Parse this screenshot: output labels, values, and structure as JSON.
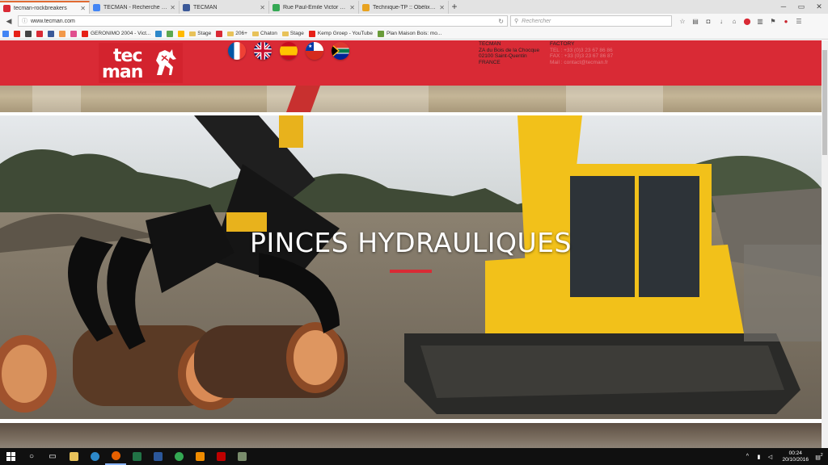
{
  "browser": {
    "tabs": [
      {
        "title": "tecman-rockbreakers",
        "favicon_color": "#d92a35",
        "active": true
      },
      {
        "title": "TECMAN - Recherche Go...",
        "favicon_color": "#4285f4",
        "active": false
      },
      {
        "title": "TECMAN",
        "favicon_color": "#3b5998",
        "active": false
      },
      {
        "title": "Rue Paul-Emile Victor - G...",
        "favicon_color": "#34a853",
        "active": false
      },
      {
        "title": "Technique-TP :: Obélix de ...",
        "favicon_color": "#e8a21f",
        "active": false
      }
    ],
    "new_tab_label": "+",
    "url": "www.tecman.com",
    "search_placeholder": "Rechercher",
    "bookmarks": [
      {
        "label": "",
        "color": "#4285f4",
        "folder": false
      },
      {
        "label": "",
        "color": "#e62117",
        "folder": false
      },
      {
        "label": "",
        "color": "#444444",
        "folder": false
      },
      {
        "label": "",
        "color": "#d92a35",
        "folder": false
      },
      {
        "label": "",
        "color": "#3b5998",
        "folder": false
      },
      {
        "label": "",
        "color": "#f2994a",
        "folder": false
      },
      {
        "label": "",
        "color": "#e04e8e",
        "folder": false
      },
      {
        "label": "GERONIMO 2004 - Vict...",
        "color": "#e62117",
        "folder": false
      },
      {
        "label": "",
        "color": "#2d88c9",
        "folder": false
      },
      {
        "label": "",
        "color": "#5ca84f",
        "folder": false
      },
      {
        "label": "",
        "color": "#ffb900",
        "folder": false
      },
      {
        "label": "Stage",
        "color": "#e8c25a",
        "folder": true
      },
      {
        "label": "",
        "color": "#d92a35",
        "folder": false
      },
      {
        "label": "206+",
        "color": "#e8c25a",
        "folder": true
      },
      {
        "label": "Chaton",
        "color": "#e8c25a",
        "folder": true
      },
      {
        "label": "Stage",
        "color": "#e8c25a",
        "folder": true
      },
      {
        "label": "Kemp Groep - YouTube",
        "color": "#e62117",
        "folder": false
      },
      {
        "label": "Plan Maison Bois: mo...",
        "color": "#6a9c3a",
        "folder": false
      }
    ]
  },
  "site": {
    "logo_line1": "tec",
    "logo_line2": "man",
    "languages": [
      "fr",
      "en",
      "es",
      "cl",
      "za"
    ],
    "address": {
      "name": "TECMAN",
      "street": "ZA du Bois de la Chocque",
      "city": "02100 Saint-Quentin",
      "country": "FRANCE"
    },
    "factory": {
      "title": "FACTORY",
      "tel": "TEL : +33 (0)3 23 67 86 86",
      "fax": "FAX : +33 (0)3 23 67 86 87",
      "mail": "Mail : contact@tecman.fr"
    },
    "hero_title": "PINCES HYDRAULIQUES",
    "accent_color": "#d92a35"
  },
  "taskbar": {
    "time": "00:24",
    "date": "20/10/2016",
    "notification_count": "2"
  }
}
